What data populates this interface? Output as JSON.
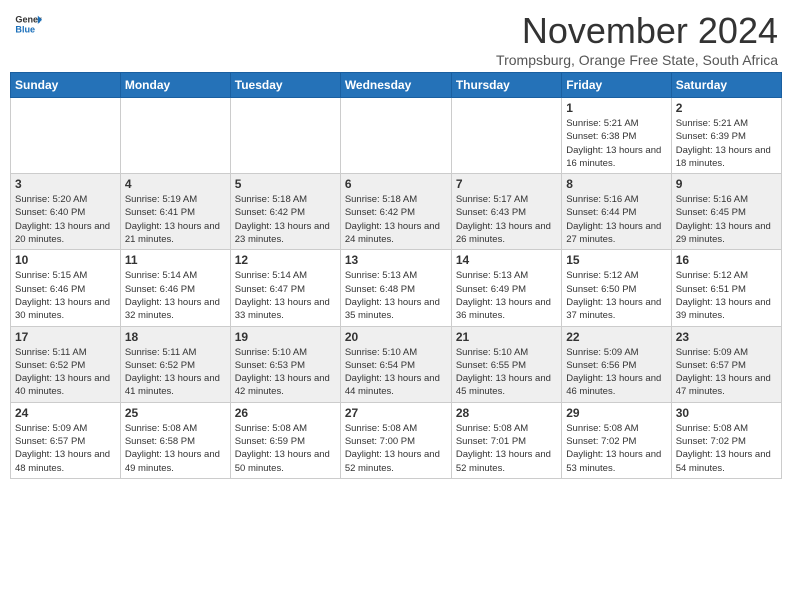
{
  "header": {
    "logo_general": "General",
    "logo_blue": "Blue",
    "month_title": "November 2024",
    "subtitle": "Trompsburg, Orange Free State, South Africa"
  },
  "days_of_week": [
    "Sunday",
    "Monday",
    "Tuesday",
    "Wednesday",
    "Thursday",
    "Friday",
    "Saturday"
  ],
  "weeks": [
    {
      "days": [
        {
          "number": "",
          "info": ""
        },
        {
          "number": "",
          "info": ""
        },
        {
          "number": "",
          "info": ""
        },
        {
          "number": "",
          "info": ""
        },
        {
          "number": "",
          "info": ""
        },
        {
          "number": "1",
          "info": "Sunrise: 5:21 AM\nSunset: 6:38 PM\nDaylight: 13 hours and 16 minutes."
        },
        {
          "number": "2",
          "info": "Sunrise: 5:21 AM\nSunset: 6:39 PM\nDaylight: 13 hours and 18 minutes."
        }
      ]
    },
    {
      "days": [
        {
          "number": "3",
          "info": "Sunrise: 5:20 AM\nSunset: 6:40 PM\nDaylight: 13 hours and 20 minutes."
        },
        {
          "number": "4",
          "info": "Sunrise: 5:19 AM\nSunset: 6:41 PM\nDaylight: 13 hours and 21 minutes."
        },
        {
          "number": "5",
          "info": "Sunrise: 5:18 AM\nSunset: 6:42 PM\nDaylight: 13 hours and 23 minutes."
        },
        {
          "number": "6",
          "info": "Sunrise: 5:18 AM\nSunset: 6:42 PM\nDaylight: 13 hours and 24 minutes."
        },
        {
          "number": "7",
          "info": "Sunrise: 5:17 AM\nSunset: 6:43 PM\nDaylight: 13 hours and 26 minutes."
        },
        {
          "number": "8",
          "info": "Sunrise: 5:16 AM\nSunset: 6:44 PM\nDaylight: 13 hours and 27 minutes."
        },
        {
          "number": "9",
          "info": "Sunrise: 5:16 AM\nSunset: 6:45 PM\nDaylight: 13 hours and 29 minutes."
        }
      ]
    },
    {
      "days": [
        {
          "number": "10",
          "info": "Sunrise: 5:15 AM\nSunset: 6:46 PM\nDaylight: 13 hours and 30 minutes."
        },
        {
          "number": "11",
          "info": "Sunrise: 5:14 AM\nSunset: 6:46 PM\nDaylight: 13 hours and 32 minutes."
        },
        {
          "number": "12",
          "info": "Sunrise: 5:14 AM\nSunset: 6:47 PM\nDaylight: 13 hours and 33 minutes."
        },
        {
          "number": "13",
          "info": "Sunrise: 5:13 AM\nSunset: 6:48 PM\nDaylight: 13 hours and 35 minutes."
        },
        {
          "number": "14",
          "info": "Sunrise: 5:13 AM\nSunset: 6:49 PM\nDaylight: 13 hours and 36 minutes."
        },
        {
          "number": "15",
          "info": "Sunrise: 5:12 AM\nSunset: 6:50 PM\nDaylight: 13 hours and 37 minutes."
        },
        {
          "number": "16",
          "info": "Sunrise: 5:12 AM\nSunset: 6:51 PM\nDaylight: 13 hours and 39 minutes."
        }
      ]
    },
    {
      "days": [
        {
          "number": "17",
          "info": "Sunrise: 5:11 AM\nSunset: 6:52 PM\nDaylight: 13 hours and 40 minutes."
        },
        {
          "number": "18",
          "info": "Sunrise: 5:11 AM\nSunset: 6:52 PM\nDaylight: 13 hours and 41 minutes."
        },
        {
          "number": "19",
          "info": "Sunrise: 5:10 AM\nSunset: 6:53 PM\nDaylight: 13 hours and 42 minutes."
        },
        {
          "number": "20",
          "info": "Sunrise: 5:10 AM\nSunset: 6:54 PM\nDaylight: 13 hours and 44 minutes."
        },
        {
          "number": "21",
          "info": "Sunrise: 5:10 AM\nSunset: 6:55 PM\nDaylight: 13 hours and 45 minutes."
        },
        {
          "number": "22",
          "info": "Sunrise: 5:09 AM\nSunset: 6:56 PM\nDaylight: 13 hours and 46 minutes."
        },
        {
          "number": "23",
          "info": "Sunrise: 5:09 AM\nSunset: 6:57 PM\nDaylight: 13 hours and 47 minutes."
        }
      ]
    },
    {
      "days": [
        {
          "number": "24",
          "info": "Sunrise: 5:09 AM\nSunset: 6:57 PM\nDaylight: 13 hours and 48 minutes."
        },
        {
          "number": "25",
          "info": "Sunrise: 5:08 AM\nSunset: 6:58 PM\nDaylight: 13 hours and 49 minutes."
        },
        {
          "number": "26",
          "info": "Sunrise: 5:08 AM\nSunset: 6:59 PM\nDaylight: 13 hours and 50 minutes."
        },
        {
          "number": "27",
          "info": "Sunrise: 5:08 AM\nSunset: 7:00 PM\nDaylight: 13 hours and 52 minutes."
        },
        {
          "number": "28",
          "info": "Sunrise: 5:08 AM\nSunset: 7:01 PM\nDaylight: 13 hours and 52 minutes."
        },
        {
          "number": "29",
          "info": "Sunrise: 5:08 AM\nSunset: 7:02 PM\nDaylight: 13 hours and 53 minutes."
        },
        {
          "number": "30",
          "info": "Sunrise: 5:08 AM\nSunset: 7:02 PM\nDaylight: 13 hours and 54 minutes."
        }
      ]
    }
  ]
}
